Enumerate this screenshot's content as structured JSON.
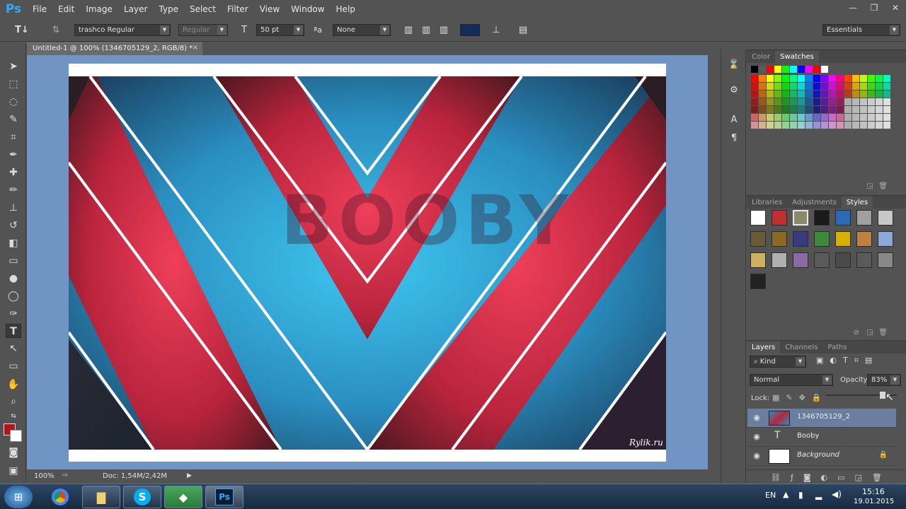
{
  "app": {
    "logo": "Ps"
  },
  "menu": [
    "File",
    "Edit",
    "Image",
    "Layer",
    "Type",
    "Select",
    "Filter",
    "View",
    "Window",
    "Help"
  ],
  "window_controls": {
    "minimize": "—",
    "restore": "❐",
    "close": "✕"
  },
  "options": {
    "font_family": "trashco Regular",
    "font_style": "Regular",
    "font_size": "50 pt",
    "aa_label": "ªa",
    "antialias": "None",
    "text_color": "#142c5c",
    "workspace": "Essentials"
  },
  "document_tab": {
    "title": "Untitled-1 @ 100% (1346705129_2, RGB/8) *",
    "close": "×"
  },
  "canvas": {
    "watermark": "Rylik.ru",
    "background_color": "#7095c4"
  },
  "status": {
    "zoom": "100%",
    "doc_size": "Doc: 1,54M/2,42M"
  },
  "color_panel": {
    "tabs": [
      "Color",
      "Swatches"
    ],
    "active": "Swatches"
  },
  "styles_panel": {
    "tabs": [
      "Libraries",
      "Adjustments",
      "Styles"
    ],
    "active": "Styles"
  },
  "layers_panel": {
    "tabs": [
      "Layers",
      "Channels",
      "Paths"
    ],
    "active": "Layers",
    "filter_kind": "Kind",
    "blend_mode": "Normal",
    "opacity_label": "Opacity:",
    "opacity": "83%",
    "lock_label": "Lock:",
    "layers": [
      {
        "name": "1346705129_2",
        "selected": true
      },
      {
        "name": "Booby",
        "selected": false
      },
      {
        "name": "Background",
        "selected": false
      }
    ]
  },
  "foreground_color": "#b3141b",
  "background_color": "#ffffff",
  "taskbar": {
    "language": "EN",
    "time": "15:16",
    "date": "19.01.2015"
  }
}
